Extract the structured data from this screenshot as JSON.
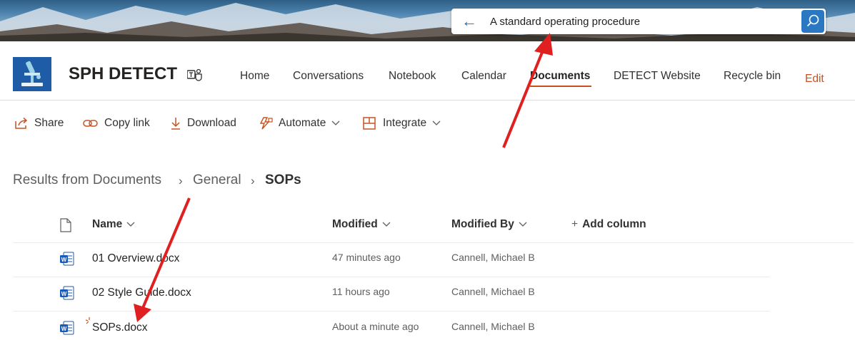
{
  "search": {
    "query": "A standard operating procedure"
  },
  "site": {
    "title": "SPH DETECT"
  },
  "nav": {
    "items": [
      "Home",
      "Conversations",
      "Notebook",
      "Calendar",
      "Documents",
      "DETECT Website",
      "Recycle bin"
    ],
    "active": "Documents",
    "edit_label": "Edit"
  },
  "commands": {
    "share": "Share",
    "copy_link": "Copy link",
    "download": "Download",
    "automate": "Automate",
    "integrate": "Integrate"
  },
  "breadcrumb": {
    "root": "Results from Documents",
    "level1": "General",
    "current": "SOPs"
  },
  "table": {
    "columns": {
      "name": "Name",
      "modified": "Modified",
      "modified_by": "Modified By",
      "add_column": "Add column"
    },
    "rows": [
      {
        "name": "01 Overview.docx",
        "modified": "47 minutes ago",
        "modified_by": "Cannell, Michael B"
      },
      {
        "name": "02 Style Guide.docx",
        "modified": "11 hours ago",
        "modified_by": "Cannell, Michael B"
      },
      {
        "name": "SOPs.docx",
        "modified": "About a minute ago",
        "modified_by": "Cannell, Michael B"
      }
    ]
  },
  "colors": {
    "accent": "#c7521f",
    "search_button": "#2b78c2",
    "annotation_arrow": "#e02020",
    "word_blue": "#185abd"
  },
  "icons": [
    "arrow-left-icon",
    "search-icon",
    "teams-icon",
    "share-icon",
    "link-icon",
    "download-icon",
    "automate-icon",
    "integrate-icon",
    "chevron-down-icon",
    "file-icon",
    "word-doc-icon",
    "plus-icon",
    "new-item-sparkle-icon"
  ]
}
